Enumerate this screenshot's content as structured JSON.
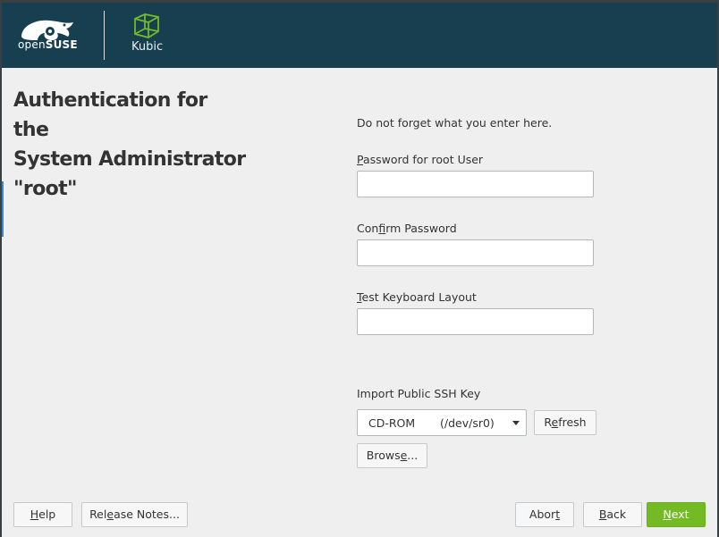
{
  "banner": {
    "brand_prefix": "open",
    "brand_name": "SUSE",
    "product": "Kubic"
  },
  "page": {
    "title_line1": "Authentication for the",
    "title_line2": "System Administrator",
    "title_line3": "\"root\""
  },
  "form": {
    "hint": "Do not forget what you enter here.",
    "password_label_key": "P",
    "password_label_rest": "assword for root User",
    "password_value": "",
    "confirm_label_pre": "Con",
    "confirm_label_key": "f",
    "confirm_label_rest": "irm Password",
    "confirm_value": "",
    "keyboard_label_key": "T",
    "keyboard_label_rest": "est Keyboard Layout",
    "keyboard_value": "",
    "ssh_label": "Import Public SSH Key",
    "ssh_device": "CD-ROM",
    "ssh_device_path": "(/dev/sr0)",
    "refresh_pre": "R",
    "refresh_key": "e",
    "refresh_rest": "fresh",
    "browse_pre": "Brows",
    "browse_key": "e",
    "browse_rest": "..."
  },
  "buttons": {
    "help_key": "H",
    "help_rest": "elp",
    "release_pre": "Rel",
    "release_key": "e",
    "release_rest": "ase Notes...",
    "abort_pre": "Abor",
    "abort_key": "t",
    "back_key": "B",
    "back_rest": "ack",
    "next_key": "N",
    "next_rest": "ext"
  },
  "colors": {
    "banner": "#173f4f",
    "accent_green": "#73ba25",
    "background": "#efefef"
  }
}
